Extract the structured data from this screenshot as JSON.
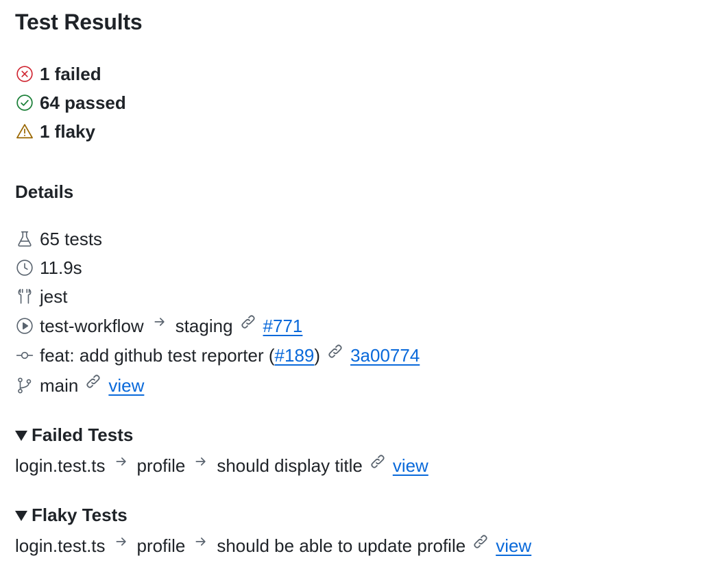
{
  "title": "Test Results",
  "summary": {
    "failed": "1 failed",
    "passed": "64 passed",
    "flaky": "1 flaky"
  },
  "details": {
    "heading": "Details",
    "tests": "65 tests",
    "duration": "11.9s",
    "framework": "jest",
    "workflow": {
      "name": "test-workflow",
      "environment": "staging",
      "run_link": "#771"
    },
    "commit": {
      "message_prefix": "feat: add github test reporter (",
      "pr_link": "#189",
      "message_suffix": ")",
      "sha_link": "3a00774"
    },
    "branch": {
      "name": "main",
      "link": "view"
    }
  },
  "failed_tests": {
    "heading": "Failed Tests",
    "items": [
      {
        "file": "login.test.ts",
        "suite": "profile",
        "name": "should display title",
        "link": "view"
      }
    ]
  },
  "flaky_tests": {
    "heading": "Flaky Tests",
    "items": [
      {
        "file": "login.test.ts",
        "suite": "profile",
        "name": "should be able to update profile",
        "link": "view"
      }
    ]
  },
  "colors": {
    "failed": "#cf222e",
    "passed": "#1a7f37",
    "flaky": "#9a6700",
    "link": "#0969da",
    "text": "#1f2328",
    "muted": "#59636e"
  }
}
